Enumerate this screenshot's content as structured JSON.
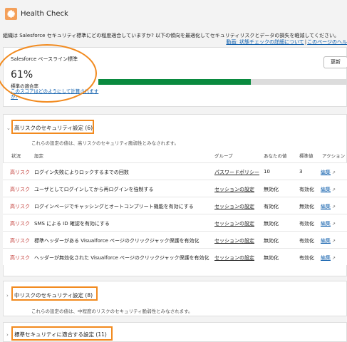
{
  "header": {
    "title": "Health Check",
    "logo_icon": "gear-icon",
    "accent": "#f4a05a"
  },
  "intro": {
    "description": "組織は Salesforce セキュリティ標準にどの程度適合していますか? 以下の傾向を最適化してセキュリティリスクとデータの損失を軽減してください。",
    "link_video": "動画: 状態チェックの詳細について",
    "link_separator": "|",
    "link_help": "このページのヘル"
  },
  "baseline": {
    "label": "Salesforce ベースライン標準",
    "score": "61%",
    "score_label": "標準の適合率",
    "help_link": "このスコアはどのようにして計算されますか?",
    "refresh_label": "更新",
    "progress_fraction": 0.61,
    "progress_color": "#0a8a3f"
  },
  "high_risk": {
    "heading": "高リスクのセキュリティ設定 (6)",
    "subtitle": "これらの設定の値は、高リスクのセキュリティ脆弱性とみなされます。",
    "columns": [
      "状況",
      "設定",
      "グループ",
      "あなたの値",
      "標準値",
      "アクション"
    ],
    "rows": [
      {
        "status": "高リスク",
        "setting": "ログイン失敗によりロックするまでの回数",
        "group": "パスワードポリシー",
        "your_value": "10",
        "standard": "3",
        "action": "編集"
      },
      {
        "status": "高リスク",
        "setting": "ユーザとしてログインしてから再ログインを強制する",
        "group": "セッションの設定",
        "your_value": "無効化",
        "standard": "有効化",
        "action": "編集"
      },
      {
        "status": "高リスク",
        "setting": "ログインページでキャッシングとオートコンプリート機能を有効にする",
        "group": "セッションの設定",
        "your_value": "有効化",
        "standard": "無効化",
        "action": "編集"
      },
      {
        "status": "高リスク",
        "setting": "SMS による ID 確認を有効にする",
        "group": "セッションの設定",
        "your_value": "無効化",
        "standard": "有効化",
        "action": "編集"
      },
      {
        "status": "高リスク",
        "setting": "標準ヘッダーがある Visualforce ページのクリックジャック保護を有効化",
        "group": "セッションの設定",
        "your_value": "無効化",
        "standard": "有効化",
        "action": "編集"
      },
      {
        "status": "高リスク",
        "setting": "ヘッダーが無効化された Visualforce ページのクリックジャック保護を有効化",
        "group": "セッションの設定",
        "your_value": "無効化",
        "standard": "有効化",
        "action": "編集"
      }
    ]
  },
  "medium_risk": {
    "heading": "中リスクのセキュリティ設定 (8)",
    "subtitle": "これらの設定の値は、中程度のリスクのセキュリティ脆弱性とみなされます。"
  },
  "compliant": {
    "heading": "標準セキュリティに適合する設定 (11)"
  },
  "colors": {
    "risk_red": "#c23934",
    "link_blue": "#0b5cab",
    "highlight_orange": "#f28a1e"
  }
}
